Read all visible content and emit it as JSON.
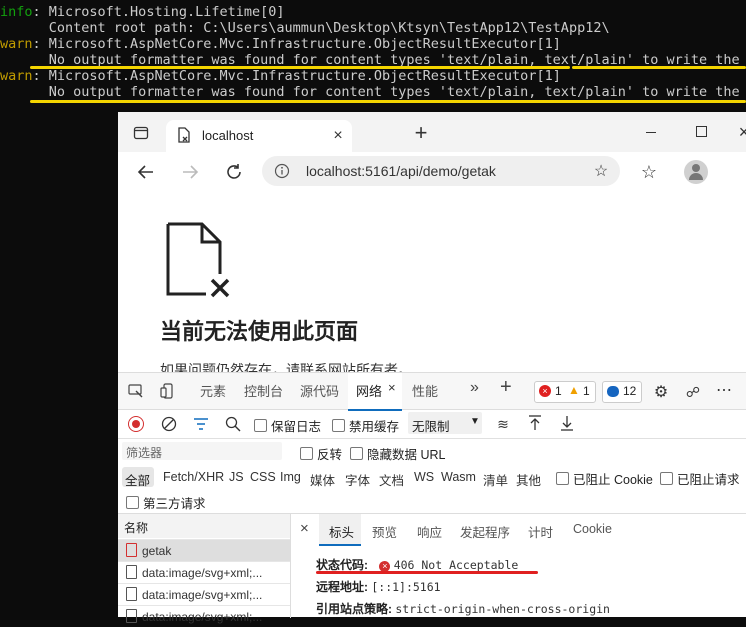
{
  "terminal": {
    "lines": [
      {
        "prefix": "info",
        "sep": ": ",
        "text": "Microsoft.Hosting.Lifetime[0]"
      },
      {
        "prefix": "",
        "sep": "",
        "text": "      Content root path: C:\\Users\\aummun\\Desktop\\Ktsyn\\TestApp12\\TestApp12\\"
      },
      {
        "prefix": "warn",
        "sep": ": ",
        "text": "Microsoft.AspNetCore.Mvc.Infrastructure.ObjectResultExecutor[1]"
      },
      {
        "prefix": "",
        "sep": "",
        "text": "      No output formatter was found for content types 'text/plain, text/plain' to write the re"
      },
      {
        "prefix": "warn",
        "sep": ": ",
        "text": "Microsoft.AspNetCore.Mvc.Infrastructure.ObjectResultExecutor[1]"
      },
      {
        "prefix": "",
        "sep": "",
        "text": "      No output formatter was found for content types 'text/plain, text/plain' to write the re"
      }
    ],
    "highlight_color": "#f4d500"
  },
  "browser": {
    "tab_title": "localhost",
    "url": "localhost:5161/api/demo/getak",
    "error_title": "当前无法使用此页面",
    "error_text": "如果问题仍然存在，请联系网站所有者。"
  },
  "devtools": {
    "tabs": [
      "元素",
      "控制台",
      "源代码",
      "网络",
      "性能"
    ],
    "active_tab": "网络",
    "badges": {
      "errors": "1",
      "warnings": "1",
      "messages": "12"
    },
    "toolbar": {
      "preserve_log": "保留日志",
      "disable_cache": "禁用缓存",
      "throttle": "无限制"
    },
    "filter": {
      "placeholder": "筛选器",
      "invert": "反转",
      "hide_data_urls": "隐藏数据 URL"
    },
    "types": [
      "全部",
      "Fetch/XHR",
      "JS",
      "CSS",
      "Img",
      "媒体",
      "字体",
      "文档",
      "WS",
      "Wasm",
      "清单",
      "其他"
    ],
    "blocked_cookies": "已阻止 Cookie",
    "blocked_requests": "已阻止请求",
    "third_party": "第三方请求",
    "name_header": "名称",
    "requests": [
      "getak",
      "data:image/svg+xml;...",
      "data:image/svg+xml;...",
      "data:image/svg+xml;..."
    ],
    "detail_tabs": [
      "标头",
      "预览",
      "响应",
      "发起程序",
      "计时",
      "Cookie"
    ],
    "active_detail_tab": "标头",
    "headers": [
      {
        "key": "状态代码:",
        "value": "406 Not Acceptable"
      },
      {
        "key": "远程地址:",
        "value": "[::1]:5161"
      },
      {
        "key": "引用站点策略:",
        "value": "strict-origin-when-cross-origin"
      }
    ],
    "status_underline_color": "#e02020"
  }
}
